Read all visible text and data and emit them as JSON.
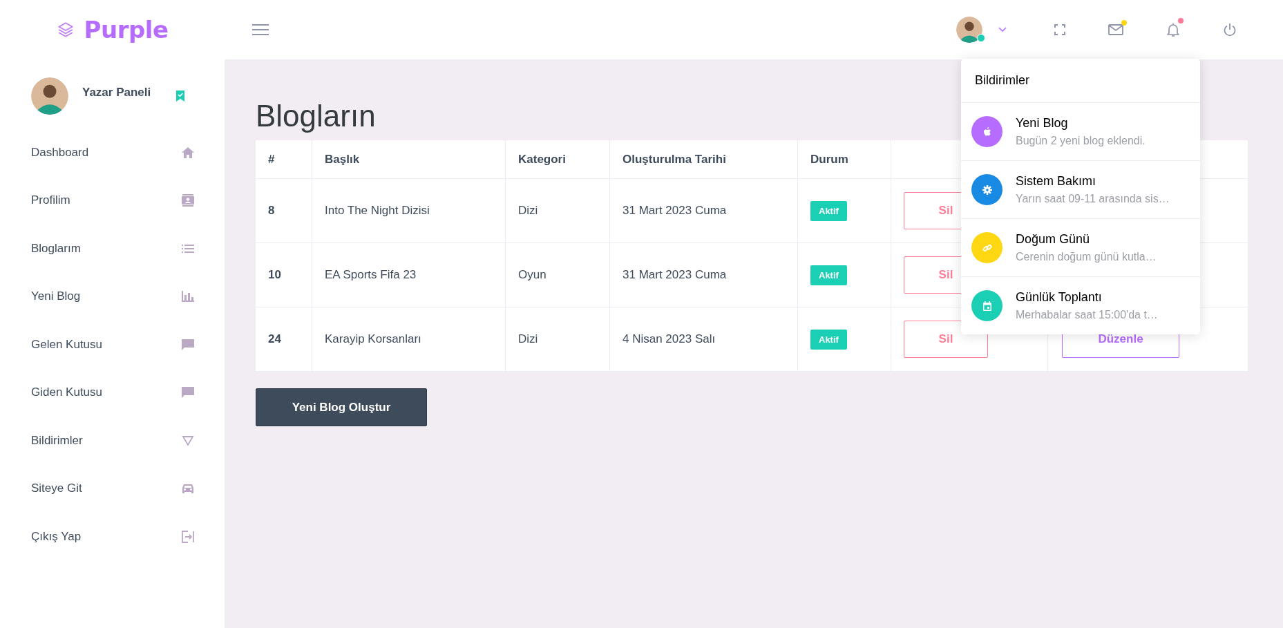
{
  "brand": {
    "name": "Purple"
  },
  "header": {
    "user_online": true,
    "mail_unread": true,
    "notifications_unread": true
  },
  "sidebar": {
    "profile": {
      "name": "Yazar Paneli"
    },
    "items": [
      {
        "label": "Dashboard"
      },
      {
        "label": "Profilim"
      },
      {
        "label": "Bloglarım"
      },
      {
        "label": "Yeni Blog"
      },
      {
        "label": "Gelen Kutusu"
      },
      {
        "label": "Giden Kutusu"
      },
      {
        "label": "Bildirimler"
      },
      {
        "label": "Siteye Git"
      },
      {
        "label": "Çıkış Yap"
      }
    ]
  },
  "page": {
    "title": "Blogların"
  },
  "table": {
    "columns": [
      "#",
      "Başlık",
      "Kategori",
      "Oluşturulma Tarihi",
      "Durum"
    ],
    "rows": [
      {
        "id": "8",
        "title": "Into The Night Dizisi",
        "category": "Dizi",
        "date": "31 Mart 2023 Cuma",
        "status": "Aktif",
        "delete": "Sil"
      },
      {
        "id": "10",
        "title": "EA Sports Fifa 23",
        "category": "Oyun",
        "date": "31 Mart 2023 Cuma",
        "status": "Aktif",
        "delete": "Sil"
      },
      {
        "id": "24",
        "title": "Karayip Korsanları",
        "category": "Dizi",
        "date": "4 Nisan 2023 Salı",
        "status": "Aktif",
        "delete": "Sil",
        "edit": "Düzenle"
      }
    ]
  },
  "create_button": "Yeni Blog Oluştur",
  "notifications": {
    "title": "Bildirimler",
    "items": [
      {
        "title": "Yeni Blog",
        "text": "Bugün 2 yeni blog eklendi.",
        "color": "#b66dff"
      },
      {
        "title": "Sistem Bakımı",
        "text": "Yarın saat 09-11 arasında sis…",
        "color": "#198ae3"
      },
      {
        "title": "Doğum Günü",
        "text": "Cerenin doğum günü kutla…",
        "color": "#fed713"
      },
      {
        "title": "Günlük Toplantı",
        "text": "Merhabalar saat 15:00'da t…",
        "color": "#1bcfb4"
      }
    ]
  }
}
